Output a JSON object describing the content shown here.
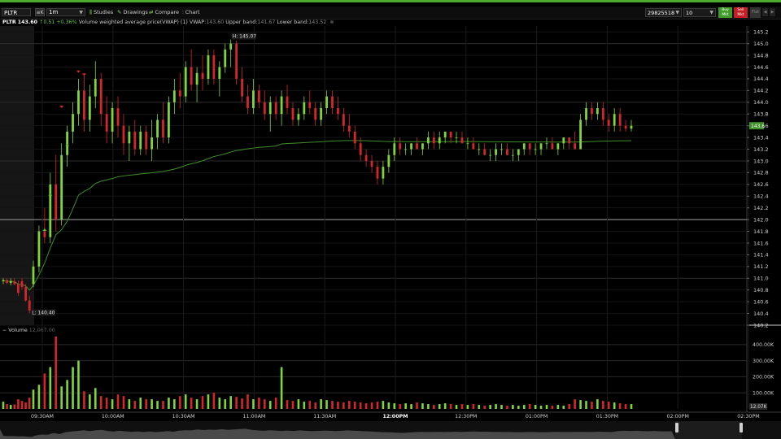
{
  "toolbar": {
    "symbol": "PLTR",
    "symbol_menu": "≡K",
    "timeframe": "1m",
    "studies_label": "Studies",
    "drawings_label": "Drawings",
    "compare_label": "Compare",
    "chart_label": "Chart",
    "account": "29825518",
    "quantity": "10",
    "buy_line1": "Buy",
    "buy_line2": "Mkt",
    "sell_line1": "Sell",
    "sell_line2": "Mkt",
    "flat_label": "Flat",
    "colors": {
      "buy": "#3f9b2a",
      "sell": "#c41e26",
      "accent": "#4fa82f"
    },
    "icons": {
      "studies": "studies-icon",
      "drawings": "drawings-icon",
      "compare": "compare-icon",
      "chart": "chart-icon",
      "dropdown": "chevron-down-icon"
    }
  },
  "legend": {
    "symbol": "PLTR",
    "last": "143.60",
    "change": "↑0.51",
    "change_pct": "+0.36%",
    "study_name": "Volume weighted average price(VWAP) (1)",
    "vwap_label": "VWAP:",
    "vwap_value": "143.60",
    "upper_label": "Upper band:",
    "upper_value": "141.67",
    "lower_label": "Lower band:",
    "lower_value": "143.52"
  },
  "volume_legend": {
    "label": "Volume",
    "value": "12,067.00"
  },
  "annotations": {
    "high": "H: 145.07",
    "low": "L: 140.40",
    "last_price_tag": "143.6",
    "last_volume_tag": "12.07K"
  },
  "chart_data": {
    "type": "candlestick",
    "price_axis": {
      "ticks": [
        "145.2",
        "145.0",
        "144.8",
        "144.6",
        "144.4",
        "144.2",
        "144.0",
        "143.8",
        "143.6",
        "143.4",
        "143.2",
        "143.0",
        "142.8",
        "142.6",
        "142.4",
        "142.2",
        "142.0",
        "141.8",
        "141.6",
        "141.4",
        "141.2",
        "141.0",
        "140.8",
        "140.6",
        "140.4",
        "140.2"
      ],
      "range": [
        140.2,
        145.3
      ]
    },
    "volume_axis": {
      "ticks": [
        "400.00K",
        "300.00K",
        "200.00K",
        "100.00K"
      ],
      "range": [
        0,
        460000
      ]
    },
    "time_axis": {
      "ticks": [
        "09:30AM",
        "10:00AM",
        "10:30AM",
        "11:00AM",
        "11:30AM",
        "12:00PM",
        "12:30PM",
        "01:00PM",
        "01:30PM",
        "02:00PM",
        "02:30PM"
      ]
    },
    "high": 145.07,
    "low": 140.4,
    "last": 143.6,
    "reference_line": 142.0,
    "colors": {
      "up": "#7fd63a",
      "down": "#d4262b",
      "vwap": "#3f8f2a",
      "grid": "#1e1e1e"
    },
    "candles": [
      {
        "o": 140.95,
        "h": 141.0,
        "l": 140.9,
        "c": 140.97
      },
      {
        "o": 140.97,
        "h": 141.0,
        "l": 140.9,
        "c": 140.92
      },
      {
        "o": 140.92,
        "h": 141.0,
        "l": 140.88,
        "c": 140.95
      },
      {
        "o": 140.95,
        "h": 141.0,
        "l": 140.88,
        "c": 140.9
      },
      {
        "o": 140.9,
        "h": 140.96,
        "l": 140.7,
        "c": 140.75
      },
      {
        "o": 140.95,
        "h": 141.0,
        "l": 140.8,
        "c": 140.85
      },
      {
        "o": 140.85,
        "h": 140.9,
        "l": 140.6,
        "c": 140.62
      },
      {
        "o": 140.62,
        "h": 140.7,
        "l": 140.4,
        "c": 140.45
      },
      {
        "o": 140.9,
        "h": 141.3,
        "l": 140.85,
        "c": 141.2
      },
      {
        "o": 141.2,
        "h": 141.9,
        "l": 141.1,
        "c": 141.8
      },
      {
        "o": 141.8,
        "h": 142.2,
        "l": 141.6,
        "c": 141.7
      },
      {
        "o": 141.7,
        "h": 142.8,
        "l": 141.6,
        "c": 142.6
      },
      {
        "o": 142.6,
        "h": 143.1,
        "l": 141.8,
        "c": 142.0
      },
      {
        "o": 142.0,
        "h": 143.3,
        "l": 141.9,
        "c": 143.1
      },
      {
        "o": 143.1,
        "h": 143.6,
        "l": 142.9,
        "c": 143.5
      },
      {
        "o": 143.5,
        "h": 144.0,
        "l": 143.3,
        "c": 143.8
      },
      {
        "o": 143.8,
        "h": 144.4,
        "l": 143.6,
        "c": 144.2
      },
      {
        "o": 144.2,
        "h": 144.5,
        "l": 143.5,
        "c": 143.7
      },
      {
        "o": 143.7,
        "h": 144.3,
        "l": 143.5,
        "c": 144.1
      },
      {
        "o": 144.1,
        "h": 144.7,
        "l": 143.9,
        "c": 144.4
      },
      {
        "o": 144.4,
        "h": 144.5,
        "l": 143.6,
        "c": 143.8
      },
      {
        "o": 143.8,
        "h": 144.1,
        "l": 143.3,
        "c": 143.5
      },
      {
        "o": 143.5,
        "h": 144.0,
        "l": 143.3,
        "c": 143.9
      },
      {
        "o": 143.9,
        "h": 144.1,
        "l": 143.4,
        "c": 143.6
      },
      {
        "o": 143.6,
        "h": 143.8,
        "l": 143.1,
        "c": 143.3
      },
      {
        "o": 143.3,
        "h": 143.6,
        "l": 143.0,
        "c": 143.5
      },
      {
        "o": 143.5,
        "h": 143.7,
        "l": 143.1,
        "c": 143.2
      },
      {
        "o": 143.2,
        "h": 143.6,
        "l": 143.1,
        "c": 143.5
      },
      {
        "o": 143.5,
        "h": 143.6,
        "l": 143.1,
        "c": 143.2
      },
      {
        "o": 143.2,
        "h": 143.7,
        "l": 143.0,
        "c": 143.4
      },
      {
        "o": 143.4,
        "h": 143.8,
        "l": 143.2,
        "c": 143.7
      },
      {
        "o": 143.7,
        "h": 144.0,
        "l": 143.3,
        "c": 143.4
      },
      {
        "o": 143.4,
        "h": 144.1,
        "l": 143.3,
        "c": 144.0
      },
      {
        "o": 144.0,
        "h": 144.4,
        "l": 143.8,
        "c": 144.2
      },
      {
        "o": 144.2,
        "h": 144.5,
        "l": 143.9,
        "c": 144.1
      },
      {
        "o": 144.1,
        "h": 144.7,
        "l": 144.0,
        "c": 144.6
      },
      {
        "o": 144.6,
        "h": 144.9,
        "l": 144.2,
        "c": 144.3
      },
      {
        "o": 144.3,
        "h": 144.6,
        "l": 144.0,
        "c": 144.5
      },
      {
        "o": 144.5,
        "h": 144.8,
        "l": 144.2,
        "c": 144.4
      },
      {
        "o": 144.4,
        "h": 144.9,
        "l": 144.3,
        "c": 144.8
      },
      {
        "o": 144.8,
        "h": 144.9,
        "l": 144.3,
        "c": 144.4
      },
      {
        "o": 144.4,
        "h": 144.7,
        "l": 144.1,
        "c": 144.6
      },
      {
        "o": 144.6,
        "h": 145.0,
        "l": 144.5,
        "c": 144.9
      },
      {
        "o": 144.9,
        "h": 145.07,
        "l": 144.6,
        "c": 145.0
      },
      {
        "o": 145.0,
        "h": 145.05,
        "l": 144.3,
        "c": 144.4
      },
      {
        "o": 144.4,
        "h": 144.6,
        "l": 144.0,
        "c": 144.1
      },
      {
        "o": 144.1,
        "h": 144.3,
        "l": 143.8,
        "c": 143.9
      },
      {
        "o": 143.9,
        "h": 144.4,
        "l": 143.8,
        "c": 144.2
      },
      {
        "o": 144.2,
        "h": 144.3,
        "l": 143.9,
        "c": 144.0
      },
      {
        "o": 144.0,
        "h": 144.2,
        "l": 143.7,
        "c": 143.8
      },
      {
        "o": 143.8,
        "h": 144.1,
        "l": 143.5,
        "c": 144.0
      },
      {
        "o": 144.0,
        "h": 144.1,
        "l": 143.7,
        "c": 143.8
      },
      {
        "o": 143.8,
        "h": 144.2,
        "l": 143.6,
        "c": 144.1
      },
      {
        "o": 144.1,
        "h": 144.3,
        "l": 143.8,
        "c": 143.9
      },
      {
        "o": 143.9,
        "h": 144.0,
        "l": 143.6,
        "c": 143.7
      },
      {
        "o": 143.7,
        "h": 143.9,
        "l": 143.6,
        "c": 143.8
      },
      {
        "o": 143.8,
        "h": 144.1,
        "l": 143.7,
        "c": 144.0
      },
      {
        "o": 144.0,
        "h": 144.2,
        "l": 143.8,
        "c": 143.9
      },
      {
        "o": 143.9,
        "h": 144.0,
        "l": 143.6,
        "c": 143.7
      },
      {
        "o": 143.7,
        "h": 144.0,
        "l": 143.6,
        "c": 143.9
      },
      {
        "o": 143.9,
        "h": 144.2,
        "l": 143.8,
        "c": 144.1
      },
      {
        "o": 144.1,
        "h": 144.2,
        "l": 143.8,
        "c": 143.9
      },
      {
        "o": 143.9,
        "h": 144.1,
        "l": 143.7,
        "c": 143.8
      },
      {
        "o": 143.8,
        "h": 143.9,
        "l": 143.5,
        "c": 143.6
      },
      {
        "o": 143.6,
        "h": 143.8,
        "l": 143.4,
        "c": 143.5
      },
      {
        "o": 143.5,
        "h": 143.6,
        "l": 143.2,
        "c": 143.3
      },
      {
        "o": 143.3,
        "h": 143.4,
        "l": 143.0,
        "c": 143.1
      },
      {
        "o": 143.1,
        "h": 143.2,
        "l": 142.9,
        "c": 143.0
      },
      {
        "o": 143.0,
        "h": 143.1,
        "l": 142.8,
        "c": 142.9
      },
      {
        "o": 142.9,
        "h": 143.0,
        "l": 142.6,
        "c": 142.7
      },
      {
        "o": 142.7,
        "h": 143.0,
        "l": 142.6,
        "c": 142.9
      },
      {
        "o": 142.9,
        "h": 143.2,
        "l": 142.8,
        "c": 143.1
      },
      {
        "o": 143.1,
        "h": 143.4,
        "l": 143.0,
        "c": 143.3
      },
      {
        "o": 143.3,
        "h": 143.4,
        "l": 143.1,
        "c": 143.2
      },
      {
        "o": 143.2,
        "h": 143.3,
        "l": 143.1,
        "c": 143.2
      },
      {
        "o": 143.2,
        "h": 143.3,
        "l": 143.1,
        "c": 143.3
      },
      {
        "o": 143.3,
        "h": 143.4,
        "l": 143.2,
        "c": 143.2
      },
      {
        "o": 143.2,
        "h": 143.3,
        "l": 143.1,
        "c": 143.3
      },
      {
        "o": 143.3,
        "h": 143.5,
        "l": 143.2,
        "c": 143.4
      },
      {
        "o": 143.4,
        "h": 143.5,
        "l": 143.2,
        "c": 143.3
      },
      {
        "o": 143.3,
        "h": 143.5,
        "l": 143.2,
        "c": 143.4
      },
      {
        "o": 143.4,
        "h": 143.5,
        "l": 143.3,
        "c": 143.5
      },
      {
        "o": 143.5,
        "h": 143.5,
        "l": 143.3,
        "c": 143.4
      },
      {
        "o": 143.4,
        "h": 143.5,
        "l": 143.3,
        "c": 143.4
      },
      {
        "o": 143.4,
        "h": 143.5,
        "l": 143.3,
        "c": 143.3
      },
      {
        "o": 143.3,
        "h": 143.4,
        "l": 143.2,
        "c": 143.3
      },
      {
        "o": 143.3,
        "h": 143.4,
        "l": 143.2,
        "c": 143.2
      },
      {
        "o": 143.2,
        "h": 143.3,
        "l": 143.1,
        "c": 143.2
      },
      {
        "o": 143.2,
        "h": 143.3,
        "l": 143.1,
        "c": 143.1
      },
      {
        "o": 143.1,
        "h": 143.2,
        "l": 143.0,
        "c": 143.1
      },
      {
        "o": 143.1,
        "h": 143.3,
        "l": 143.0,
        "c": 143.2
      },
      {
        "o": 143.2,
        "h": 143.3,
        "l": 143.1,
        "c": 143.2
      },
      {
        "o": 143.2,
        "h": 143.3,
        "l": 143.1,
        "c": 143.1
      },
      {
        "o": 143.1,
        "h": 143.2,
        "l": 143.0,
        "c": 143.1
      },
      {
        "o": 143.1,
        "h": 143.2,
        "l": 143.0,
        "c": 143.2
      },
      {
        "o": 143.2,
        "h": 143.3,
        "l": 143.1,
        "c": 143.3
      },
      {
        "o": 143.3,
        "h": 143.3,
        "l": 143.1,
        "c": 143.2
      },
      {
        "o": 143.2,
        "h": 143.3,
        "l": 143.1,
        "c": 143.2
      },
      {
        "o": 143.2,
        "h": 143.3,
        "l": 143.1,
        "c": 143.3
      },
      {
        "o": 143.3,
        "h": 143.4,
        "l": 143.2,
        "c": 143.3
      },
      {
        "o": 143.3,
        "h": 143.4,
        "l": 143.2,
        "c": 143.2
      },
      {
        "o": 143.2,
        "h": 143.3,
        "l": 143.1,
        "c": 143.3
      },
      {
        "o": 143.3,
        "h": 143.4,
        "l": 143.2,
        "c": 143.4
      },
      {
        "o": 143.4,
        "h": 143.4,
        "l": 143.2,
        "c": 143.3
      },
      {
        "o": 143.3,
        "h": 143.5,
        "l": 143.2,
        "c": 143.2
      },
      {
        "o": 143.2,
        "h": 143.8,
        "l": 143.2,
        "c": 143.7
      },
      {
        "o": 143.7,
        "h": 144.0,
        "l": 143.6,
        "c": 143.9
      },
      {
        "o": 143.9,
        "h": 144.0,
        "l": 143.7,
        "c": 143.8
      },
      {
        "o": 143.8,
        "h": 144.0,
        "l": 143.7,
        "c": 143.9
      },
      {
        "o": 143.9,
        "h": 144.0,
        "l": 143.6,
        "c": 143.7
      },
      {
        "o": 143.7,
        "h": 143.8,
        "l": 143.5,
        "c": 143.6
      },
      {
        "o": 143.6,
        "h": 143.9,
        "l": 143.5,
        "c": 143.8
      },
      {
        "o": 143.8,
        "h": 143.9,
        "l": 143.5,
        "c": 143.6
      },
      {
        "o": 143.6,
        "h": 143.7,
        "l": 143.5,
        "c": 143.55
      },
      {
        "o": 143.55,
        "h": 143.7,
        "l": 143.5,
        "c": 143.6
      }
    ],
    "volumes": [
      45000,
      30000,
      25000,
      28000,
      60000,
      50000,
      40000,
      70000,
      120000,
      150000,
      220000,
      260000,
      450000,
      140000,
      180000,
      260000,
      300000,
      110000,
      90000,
      130000,
      80000,
      70000,
      60000,
      90000,
      80000,
      60000,
      50000,
      70000,
      60000,
      60000,
      50000,
      50000,
      70000,
      60000,
      80000,
      90000,
      70000,
      60000,
      80000,
      90000,
      100000,
      70000,
      60000,
      80000,
      75000,
      65000,
      90000,
      60000,
      70000,
      60000,
      50000,
      70000,
      260000,
      55000,
      50000,
      60000,
      45000,
      50000,
      40000,
      60000,
      55000,
      50000,
      45000,
      40000,
      50000,
      45000,
      40000,
      35000,
      40000,
      45000,
      50000,
      40000,
      35000,
      30000,
      35000,
      30000,
      40000,
      35000,
      30000,
      25000,
      30000,
      35000,
      30000,
      25000,
      30000,
      25000,
      30000,
      25000,
      20000,
      25000,
      30000,
      25000,
      20000,
      25000,
      20000,
      25000,
      30000,
      25000,
      20000,
      25000,
      20000,
      25000,
      20000,
      30000,
      60000,
      55000,
      50000,
      45000,
      60000,
      50000,
      45000,
      40000,
      35000,
      30000,
      30000
    ]
  }
}
